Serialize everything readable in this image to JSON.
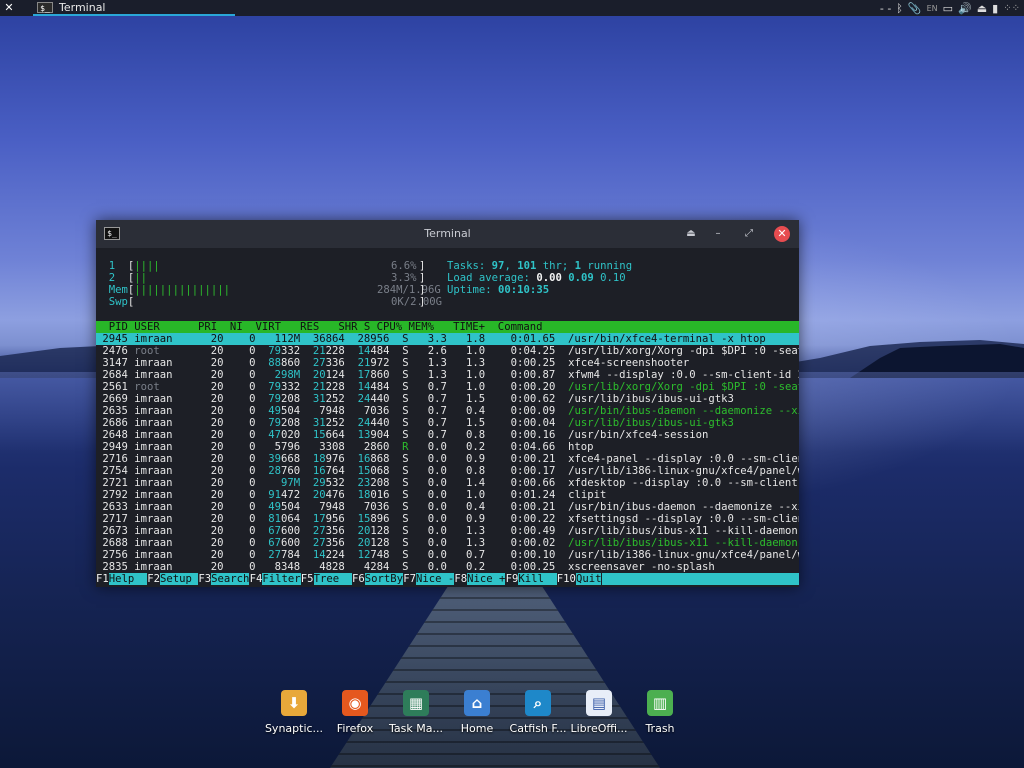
{
  "top_panel": {
    "task_icon": "$_",
    "task_title": "Terminal",
    "tray_items": [
      "- -",
      "bluetooth-icon",
      "clip-icon",
      "EN",
      "network-icon",
      "volume-icon",
      "eject-icon",
      "battery-icon"
    ],
    "tray_lang": "EN"
  },
  "window": {
    "icon": "$_",
    "title": "Terminal"
  },
  "htop": {
    "meters": [
      {
        "label": "1",
        "bars": "||||",
        "value": "6.6%"
      },
      {
        "label": "2",
        "bars": "||",
        "value": "3.3%"
      },
      {
        "label": "Mem",
        "bars": "|||||||||||||||",
        "value": "284M/1.96G"
      },
      {
        "label": "Swp",
        "bars": "",
        "value": "0K/2.00G"
      }
    ],
    "tasks_label": "Tasks:",
    "tasks": "97",
    "thr": "101",
    "thr_label": "thr;",
    "running": "1",
    "running_label": "running",
    "load_label": "Load average:",
    "load1": "0.00",
    "load5": "0.09",
    "load15": "0.10",
    "uptime_label": "Uptime:",
    "uptime": "00:10:35",
    "header": "  PID USER      PRI  NI  VIRT   RES   SHR S CPU% MEM%   TIME+  Command",
    "rows": [
      {
        "pid": "2945",
        "user": "imraan",
        "pri": "20",
        "ni": "0",
        "virt": "112M",
        "res": "36864",
        "shr": "28956",
        "s": "S",
        "cpu": "3.3",
        "mem": "1.8",
        "time": "0:01.65",
        "cmd": "/usr/bin/xfce4-terminal -x htop"
      },
      {
        "pid": "2476",
        "user": "root",
        "pri": "20",
        "ni": "0",
        "virt": "79332",
        "res": "21228",
        "shr": "14484",
        "s": "S",
        "cpu": "2.6",
        "mem": "1.0",
        "time": "0:04.25",
        "cmd": "/usr/lib/xorg/Xorg -dpi $DPI :0 -seat"
      },
      {
        "pid": "3147",
        "user": "imraan",
        "pri": "20",
        "ni": "0",
        "virt": "88860",
        "res": "27336",
        "shr": "21972",
        "s": "S",
        "cpu": "1.3",
        "mem": "1.3",
        "time": "0:00.25",
        "cmd": "xfce4-screenshooter"
      },
      {
        "pid": "2684",
        "user": "imraan",
        "pri": "20",
        "ni": "0",
        "virt": "298M",
        "res": "20124",
        "shr": "17860",
        "s": "S",
        "cpu": "1.3",
        "mem": "1.0",
        "time": "0:00.87",
        "cmd": "xfwm4 --display :0.0 --sm-client-id 2"
      },
      {
        "pid": "2561",
        "user": "root",
        "pri": "20",
        "ni": "0",
        "virt": "79332",
        "res": "21228",
        "shr": "14484",
        "s": "S",
        "cpu": "0.7",
        "mem": "1.0",
        "time": "0:00.20",
        "cmd": "/usr/lib/xorg/Xorg -dpi $DPI :0 -seat"
      },
      {
        "pid": "2669",
        "user": "imraan",
        "pri": "20",
        "ni": "0",
        "virt": "79208",
        "res": "31252",
        "shr": "24440",
        "s": "S",
        "cpu": "0.7",
        "mem": "1.5",
        "time": "0:00.62",
        "cmd": "/usr/lib/ibus/ibus-ui-gtk3"
      },
      {
        "pid": "2635",
        "user": "imraan",
        "pri": "20",
        "ni": "0",
        "virt": "49504",
        "res": "7948",
        "shr": "7036",
        "s": "S",
        "cpu": "0.7",
        "mem": "0.4",
        "time": "0:00.09",
        "cmd": "/usr/bin/ibus-daemon --daemonize --xi"
      },
      {
        "pid": "2686",
        "user": "imraan",
        "pri": "20",
        "ni": "0",
        "virt": "79208",
        "res": "31252",
        "shr": "24440",
        "s": "S",
        "cpu": "0.7",
        "mem": "1.5",
        "time": "0:00.04",
        "cmd": "/usr/lib/ibus/ibus-ui-gtk3"
      },
      {
        "pid": "2648",
        "user": "imraan",
        "pri": "20",
        "ni": "0",
        "virt": "47020",
        "res": "15664",
        "shr": "13904",
        "s": "S",
        "cpu": "0.7",
        "mem": "0.8",
        "time": "0:00.16",
        "cmd": "/usr/bin/xfce4-session"
      },
      {
        "pid": "2949",
        "user": "imraan",
        "pri": "20",
        "ni": "0",
        "virt": "5796",
        "res": "3308",
        "shr": "2860",
        "s": "R",
        "cpu": "0.0",
        "mem": "0.2",
        "time": "0:04.66",
        "cmd": "htop"
      },
      {
        "pid": "2716",
        "user": "imraan",
        "pri": "20",
        "ni": "0",
        "virt": "39668",
        "res": "18976",
        "shr": "16868",
        "s": "S",
        "cpu": "0.0",
        "mem": "0.9",
        "time": "0:00.21",
        "cmd": "xfce4-panel --display :0.0 --sm-clien"
      },
      {
        "pid": "2754",
        "user": "imraan",
        "pri": "20",
        "ni": "0",
        "virt": "28760",
        "res": "16764",
        "shr": "15068",
        "s": "S",
        "cpu": "0.0",
        "mem": "0.8",
        "time": "0:00.17",
        "cmd": "/usr/lib/i386-linux-gnu/xfce4/panel/w"
      },
      {
        "pid": "2721",
        "user": "imraan",
        "pri": "20",
        "ni": "0",
        "virt": "97M",
        "res": "29532",
        "shr": "23208",
        "s": "S",
        "cpu": "0.0",
        "mem": "1.4",
        "time": "0:00.66",
        "cmd": "xfdesktop --display :0.0 --sm-client-"
      },
      {
        "pid": "2792",
        "user": "imraan",
        "pri": "20",
        "ni": "0",
        "virt": "91472",
        "res": "20476",
        "shr": "18016",
        "s": "S",
        "cpu": "0.0",
        "mem": "1.0",
        "time": "0:01.24",
        "cmd": "clipit"
      },
      {
        "pid": "2633",
        "user": "imraan",
        "pri": "20",
        "ni": "0",
        "virt": "49504",
        "res": "7948",
        "shr": "7036",
        "s": "S",
        "cpu": "0.0",
        "mem": "0.4",
        "time": "0:00.21",
        "cmd": "/usr/bin/ibus-daemon --daemonize --xi"
      },
      {
        "pid": "2717",
        "user": "imraan",
        "pri": "20",
        "ni": "0",
        "virt": "81064",
        "res": "17956",
        "shr": "15896",
        "s": "S",
        "cpu": "0.0",
        "mem": "0.9",
        "time": "0:00.22",
        "cmd": "xfsettingsd --display :0.0 --sm-clien"
      },
      {
        "pid": "2673",
        "user": "imraan",
        "pri": "20",
        "ni": "0",
        "virt": "67600",
        "res": "27356",
        "shr": "20128",
        "s": "S",
        "cpu": "0.0",
        "mem": "1.3",
        "time": "0:00.49",
        "cmd": "/usr/lib/ibus/ibus-x11 --kill-daemon"
      },
      {
        "pid": "2688",
        "user": "imraan",
        "pri": "20",
        "ni": "0",
        "virt": "67600",
        "res": "27356",
        "shr": "20128",
        "s": "S",
        "cpu": "0.0",
        "mem": "1.3",
        "time": "0:00.02",
        "cmd": "/usr/lib/ibus/ibus-x11 --kill-daemon"
      },
      {
        "pid": "2756",
        "user": "imraan",
        "pri": "20",
        "ni": "0",
        "virt": "27784",
        "res": "14224",
        "shr": "12748",
        "s": "S",
        "cpu": "0.0",
        "mem": "0.7",
        "time": "0:00.10",
        "cmd": "/usr/lib/i386-linux-gnu/xfce4/panel/w"
      },
      {
        "pid": "2835",
        "user": "imraan",
        "pri": "20",
        "ni": "0",
        "virt": "8348",
        "res": "4828",
        "shr": "4284",
        "s": "S",
        "cpu": "0.0",
        "mem": "0.2",
        "time": "0:00.25",
        "cmd": "xscreensaver -no-splash"
      }
    ],
    "fkeys": [
      {
        "key": "F1",
        "label": "Help  "
      },
      {
        "key": "F2",
        "label": "Setup "
      },
      {
        "key": "F3",
        "label": "Search"
      },
      {
        "key": "F4",
        "label": "Filter"
      },
      {
        "key": "F5",
        "label": "Tree  "
      },
      {
        "key": "F6",
        "label": "SortBy"
      },
      {
        "key": "F7",
        "label": "Nice -"
      },
      {
        "key": "F8",
        "label": "Nice +"
      },
      {
        "key": "F9",
        "label": "Kill  "
      },
      {
        "key": "F10",
        "label": "Quit"
      }
    ]
  },
  "desktop_icons": [
    {
      "label": "Synaptic...",
      "icon": "download-icon",
      "color": "#e8a83a"
    },
    {
      "label": "Firefox",
      "icon": "firefox-icon",
      "color": "#e5581e"
    },
    {
      "label": "Task Ma...",
      "icon": "task-manager-icon",
      "color": "#2e7d5a"
    },
    {
      "label": "Home",
      "icon": "home-folder-icon",
      "color": "#3b7fd1"
    },
    {
      "label": "Catfish F...",
      "icon": "search-icon",
      "color": "#1e88c9"
    },
    {
      "label": "LibreOffi...",
      "icon": "document-icon",
      "color": "#e8eef8"
    },
    {
      "label": "Trash",
      "icon": "trash-icon",
      "color": "#4caf50"
    }
  ]
}
